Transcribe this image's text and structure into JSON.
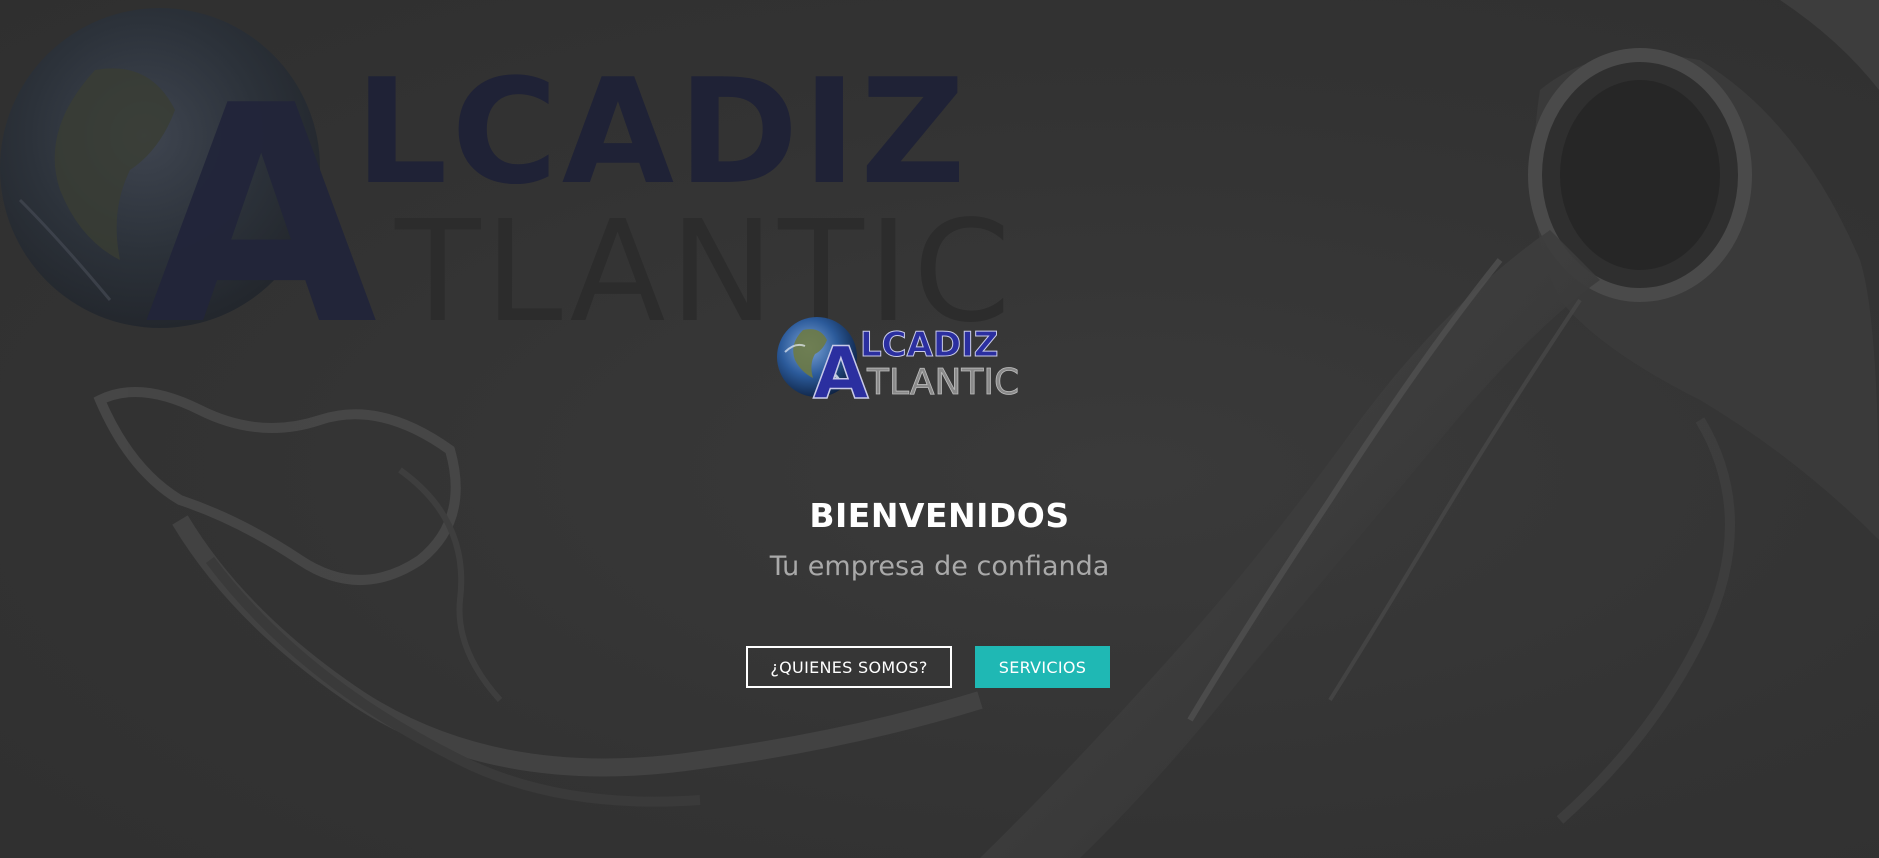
{
  "hero": {
    "title": "BIENVENIDOS",
    "subtitle": "Tu empresa de confianda"
  },
  "logo": {
    "line1": "LCADIZ",
    "line2": "TLANTIC",
    "initial": "A"
  },
  "background_logo": {
    "line1": "LCADIZ",
    "line2": "TLANTIC",
    "initial": "A"
  },
  "buttons": {
    "about_label": "¿QUIENES SOMOS?",
    "services_label": "SERVICIOS"
  },
  "colors": {
    "accent": "#1fb8b4",
    "background": "#343434",
    "logo_blue": "#2b2fa0",
    "logo_gray": "#8a8a8a"
  }
}
